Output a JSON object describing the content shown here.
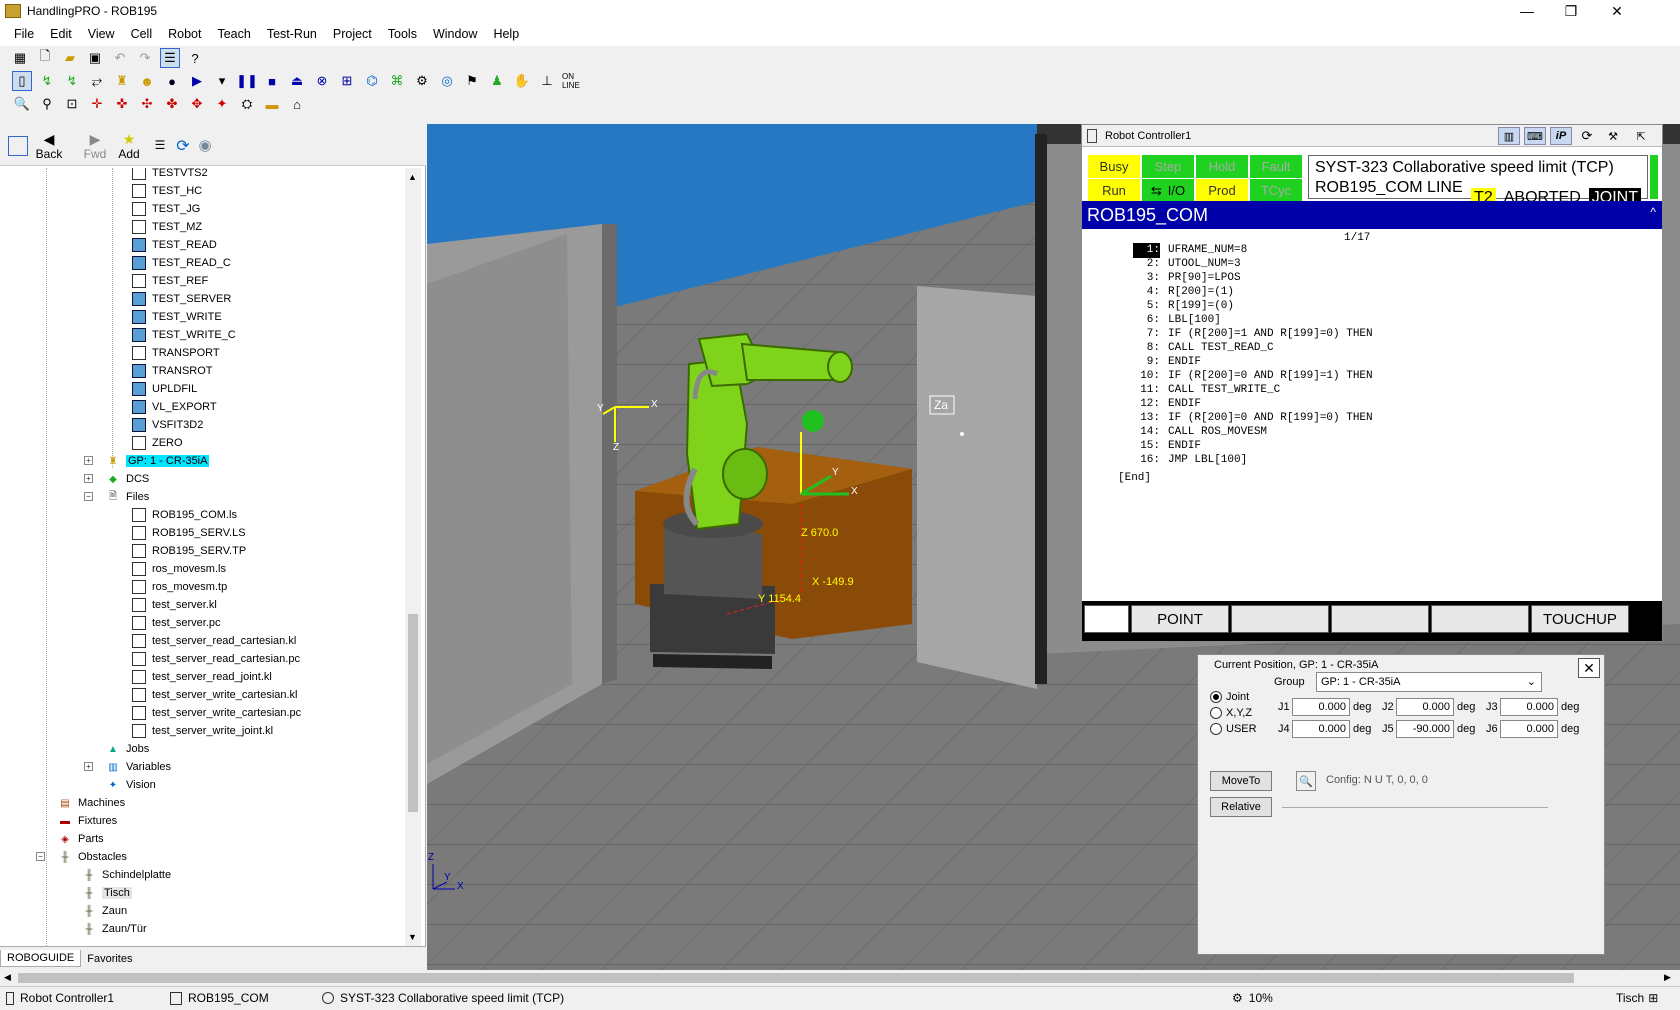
{
  "window": {
    "title": "HandlingPRO - ROB195"
  },
  "menu": [
    "File",
    "Edit",
    "View",
    "Cell",
    "Robot",
    "Teach",
    "Test-Run",
    "Project",
    "Tools",
    "Window",
    "Help"
  ],
  "nav": {
    "back": "Back",
    "fwd": "Fwd",
    "add": "Add"
  },
  "tree": {
    "programs": [
      "TESTVTS2",
      "TEST_HC",
      "TEST_JG",
      "TEST_MZ",
      "TEST_READ",
      "TEST_READ_C",
      "TEST_REF",
      "TEST_SERVER",
      "TEST_WRITE",
      "TEST_WRITE_C",
      "TRANSPORT",
      "TRANSROT",
      "UPLDFIL",
      "VL_EXPORT",
      "VSFIT3D2",
      "ZERO"
    ],
    "gp": "GP: 1 - CR-35iA",
    "dcs": "DCS",
    "files": "Files",
    "file_items": [
      "ROB195_COM.ls",
      "ROB195_SERV.LS",
      "ROB195_SERV.TP",
      "ros_movesm.ls",
      "ros_movesm.tp",
      "test_server.kl",
      "test_server.pc",
      "test_server_read_cartesian.kl",
      "test_server_read_cartesian.pc",
      "test_server_read_joint.kl",
      "test_server_write_cartesian.kl",
      "test_server_write_cartesian.pc",
      "test_server_write_joint.kl"
    ],
    "jobs": "Jobs",
    "variables": "Variables",
    "vision": "Vision",
    "machines": "Machines",
    "fixtures": "Fixtures",
    "parts": "Parts",
    "obstacles": "Obstacles",
    "obstacle_items": [
      "Schindelplatte",
      "Tisch",
      "Zaun",
      "Zaun/Tür"
    ]
  },
  "left_tabs": [
    "ROBOGUIDE",
    "Favorites"
  ],
  "viewport": {
    "z_label": "Z 670.0",
    "x_label": "X -149.9",
    "y_label": "Y 1154.4",
    "za_label": "Za",
    "axis_x": "X",
    "axis_y": "Y",
    "axis_z": "Z"
  },
  "controller": {
    "title": "Robot Controller1",
    "status": {
      "busy": "Busy",
      "step": "Step",
      "hold": "Hold",
      "fault": "Fault",
      "run": "Run",
      "io": "I/O",
      "prod": "Prod",
      "tcyc": "TCyc"
    },
    "alarm_line1": "SYST-323 Collaborative speed limit (TCP)",
    "alarm_line2": "ROB195_COM LINE 0",
    "mode": "T2",
    "state": "ABORTED",
    "coord": "JOINT",
    "program_name": "ROB195_COM",
    "line_counter": "1/17",
    "lines": [
      {
        "n": "1:",
        "t": "UFRAME_NUM=8"
      },
      {
        "n": "2:",
        "t": "UTOOL_NUM=3"
      },
      {
        "n": "3:",
        "t": "PR[90]=LPOS"
      },
      {
        "n": "4:",
        "t": "R[200]=(1)"
      },
      {
        "n": "5:",
        "t": "R[199]=(0)"
      },
      {
        "n": "6:",
        "t": "LBL[100]"
      },
      {
        "n": "7:",
        "t": "IF (R[200]=1 AND R[199]=0) THEN"
      },
      {
        "n": "8:",
        "t": "CALL TEST_READ_C"
      },
      {
        "n": "9:",
        "t": "ENDIF"
      },
      {
        "n": "10:",
        "t": "IF (R[200]=0 AND R[199]=1) THEN"
      },
      {
        "n": "11:",
        "t": "CALL TEST_WRITE_C"
      },
      {
        "n": "12:",
        "t": "ENDIF"
      },
      {
        "n": "13:",
        "t": "IF (R[200]=0 AND R[199]=0) THEN"
      },
      {
        "n": "14:",
        "t": "CALL ROS_MOVESM"
      },
      {
        "n": "15:",
        "t": "ENDIF"
      },
      {
        "n": "16:",
        "t": "JMP LBL[100]"
      }
    ],
    "end_marker": "[End]",
    "fkeys": [
      "",
      "POINT",
      "",
      "",
      "",
      "TOUCHUP"
    ]
  },
  "current_position": {
    "title": "Current Position, GP: 1 - CR-35iA",
    "group_label": "Group",
    "group_value": "GP: 1 - CR-35iA",
    "modes": [
      "Joint",
      "X,Y,Z",
      "USER"
    ],
    "selected_mode": "Joint",
    "joints": [
      {
        "label": "J1",
        "value": "0.000",
        "unit": "deg"
      },
      {
        "label": "J2",
        "value": "0.000",
        "unit": "deg"
      },
      {
        "label": "J3",
        "value": "0.000",
        "unit": "deg"
      },
      {
        "label": "J4",
        "value": "0.000",
        "unit": "deg"
      },
      {
        "label": "J5",
        "value": "-90.000",
        "unit": "deg"
      },
      {
        "label": "J6",
        "value": "0.000",
        "unit": "deg"
      }
    ],
    "moveto": "MoveTo",
    "relative": "Relative",
    "config": "Config: N U T, 0, 0, 0"
  },
  "statusbar": {
    "controller": "Robot Controller1",
    "program": "ROB195_COM",
    "alarm": "SYST-323 Collaborative speed limit (TCP)",
    "speed": "10%",
    "object": "Tisch"
  }
}
